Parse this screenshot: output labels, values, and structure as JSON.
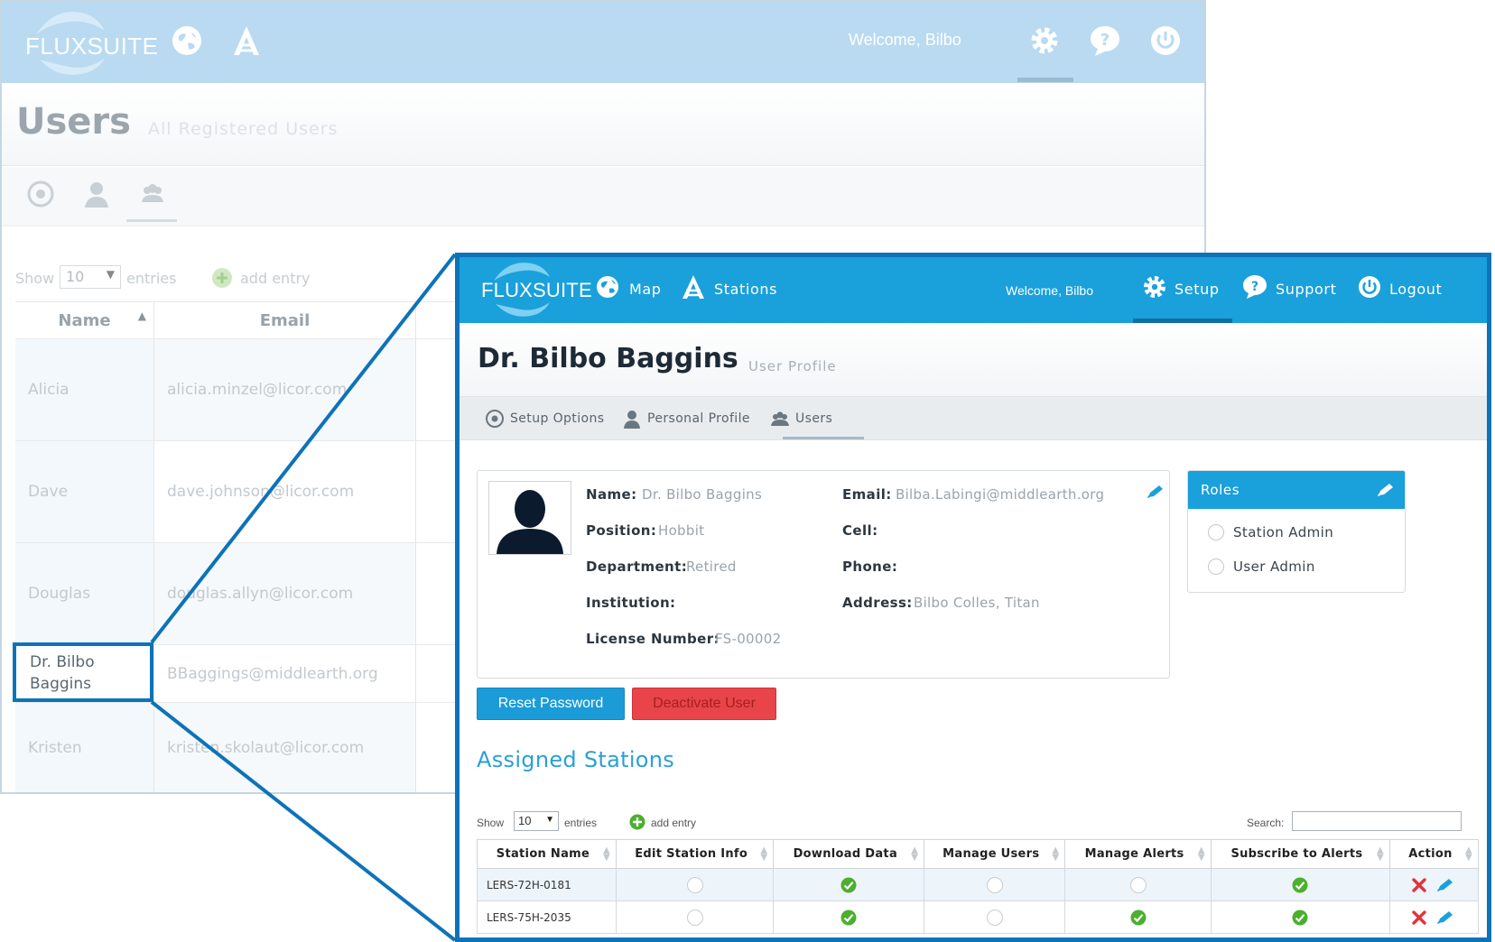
{
  "background_app": {
    "logo": "FLUXSUITE",
    "welcome": "Welcome, Bilbo",
    "page_title": "Users",
    "page_subtitle": "All Registered Users",
    "show_label": "Show",
    "show_value": "10",
    "entries_label": "entries",
    "add_entry_label": "add entry",
    "columns": [
      "Name",
      "Email"
    ],
    "rows": [
      {
        "name": "Alicia",
        "email": "alicia.minzel@licor.com"
      },
      {
        "name": "Dave",
        "email": "dave.johnson@licor.com"
      },
      {
        "name": "Douglas",
        "email": "douglas.allyn@licor.com"
      },
      {
        "name": "Dr. Bilbo Baggins",
        "email": "BBaggings@middlearth.org"
      },
      {
        "name": "Kristen",
        "email": "kristen.skolaut@licor.com"
      }
    ],
    "highlighted_name": "Dr. Bilbo Baggins"
  },
  "nav": {
    "logo": "FLUXSUITE",
    "map_label": "Map",
    "stations_label": "Stations",
    "welcome": "Welcome, Bilbo",
    "setup_label": "Setup",
    "support_label": "Support",
    "logout_label": "Logout",
    "active": "Setup"
  },
  "header": {
    "title": "Dr. Bilbo Baggins",
    "subtitle": "User Profile"
  },
  "subnav": {
    "setup_options": "Setup Options",
    "personal_profile": "Personal Profile",
    "users": "Users",
    "active": "Users"
  },
  "profile": {
    "name_label": "Name:",
    "name_value": "Dr. Bilbo Baggins",
    "position_label": "Position:",
    "position_value": "Hobbit",
    "department_label": "Department:",
    "department_value": "Retired",
    "institution_label": "Institution:",
    "institution_value": "",
    "license_label": "License Number:",
    "license_value": "FS-00002",
    "email_label": "Email:",
    "email_value": "Bilba.Labingi@middlearth.org",
    "cell_label": "Cell:",
    "cell_value": "",
    "phone_label": "Phone:",
    "phone_value": "",
    "address_label": "Address:",
    "address_value": "Bilbo Colles, Titan"
  },
  "roles": {
    "title": "Roles",
    "items": [
      {
        "label": "Station Admin",
        "checked": false
      },
      {
        "label": "User Admin",
        "checked": false
      }
    ]
  },
  "buttons": {
    "reset_password": "Reset Password",
    "deactivate_user": "Deactivate User"
  },
  "assigned": {
    "title": "Assigned Stations",
    "show_label": "Show",
    "show_value": "10",
    "entries_label": "entries",
    "add_entry_label": "add entry",
    "search_label": "Search:",
    "search_value": "",
    "columns": [
      "Station Name",
      "Edit Station Info",
      "Download Data",
      "Manage Users",
      "Manage Alerts",
      "Subscribe to Alerts",
      "Action"
    ],
    "rows": [
      {
        "station": "LERS-72H-0181",
        "edit_station_info": false,
        "download_data": true,
        "manage_users": false,
        "manage_alerts": false,
        "subscribe_alerts": true
      },
      {
        "station": "LERS-75H-2035",
        "edit_station_info": false,
        "download_data": true,
        "manage_users": false,
        "manage_alerts": true,
        "subscribe_alerts": true
      }
    ]
  },
  "colors": {
    "brand_blue": "#1aa0db",
    "callout_blue": "#0d73b8",
    "danger_red": "#e84449",
    "check_green": "#4caf2e"
  }
}
